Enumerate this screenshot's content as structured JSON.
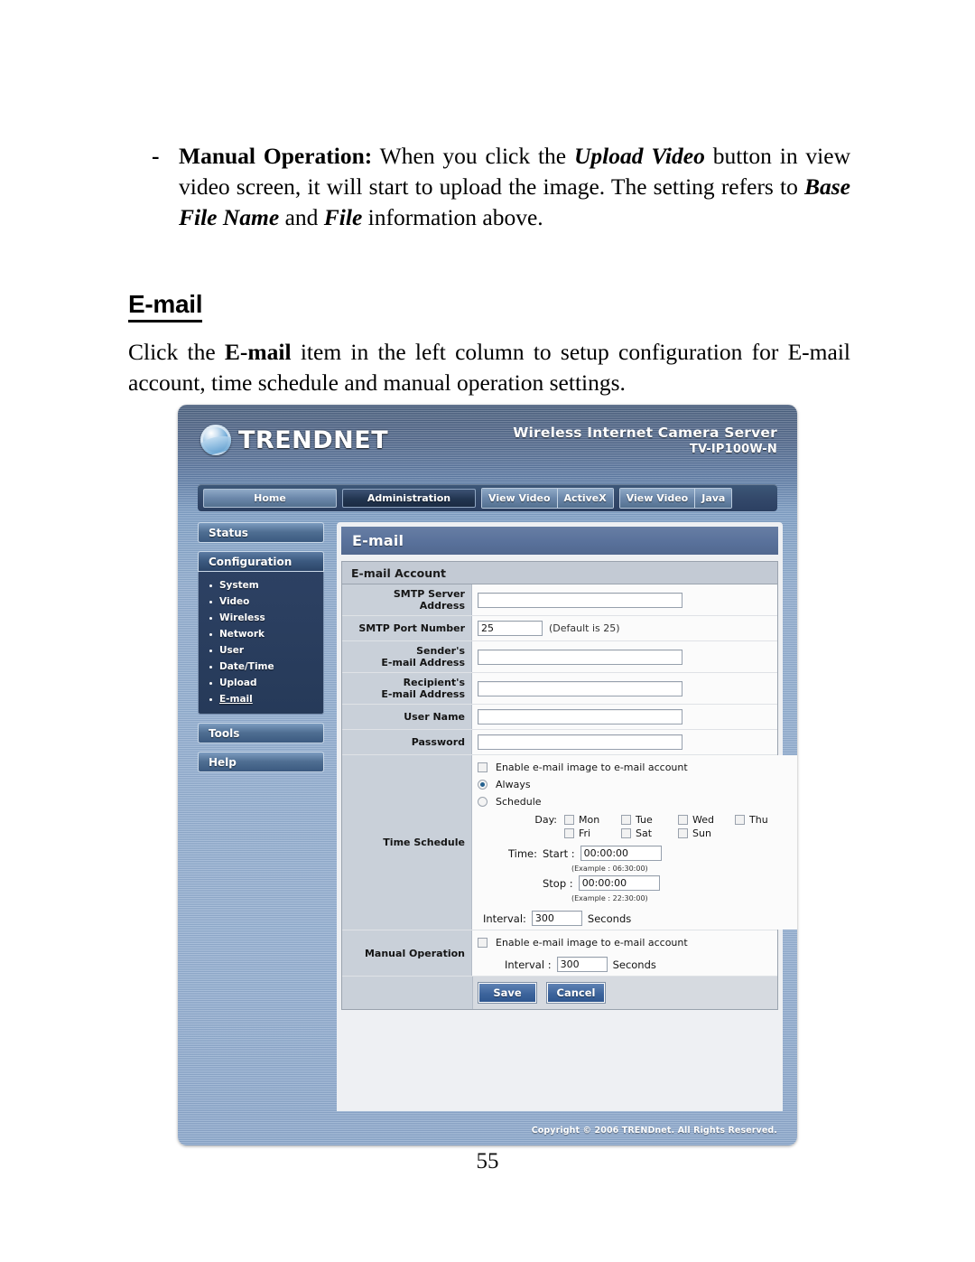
{
  "document": {
    "bullet_dash": "-",
    "manual_paragraph": {
      "lead_bold": "Manual Operation:",
      "t1": " When you click the ",
      "i1": "Upload Video",
      "t2": " button in view video screen, it will start to upload the image.  The setting refers to ",
      "i2": "Base File Name",
      "t3": " and ",
      "i3": "File",
      "t4": " information above."
    },
    "section_heading": "E-mail",
    "click_paragraph": {
      "t1": "Click the ",
      "b1": "E-mail",
      "t2": " item in the left column to setup configuration for E-mail account, time schedule and manual operation settings."
    },
    "page_number": "55"
  },
  "screenshot": {
    "brand": {
      "logo_text": "TRENDNET",
      "logo_icon": "globe-icon",
      "product_line1": "Wireless Internet Camera Server",
      "product_line2": "TV-IP100W-N"
    },
    "nav": {
      "home": "Home",
      "administration": "Administration",
      "viewvideo_activex": {
        "left": "View Video",
        "right": "ActiveX"
      },
      "viewvideo_java": {
        "left": "View Video",
        "right": "Java"
      },
      "active": "Administration"
    },
    "sidebar": {
      "status": "Status",
      "configuration": "Configuration",
      "sub_items": [
        {
          "label": "System",
          "active": false
        },
        {
          "label": "Video",
          "active": false
        },
        {
          "label": "Wireless",
          "active": false
        },
        {
          "label": "Network",
          "active": false
        },
        {
          "label": "User",
          "active": false
        },
        {
          "label": "Date/Time",
          "active": false
        },
        {
          "label": "Upload",
          "active": false
        },
        {
          "label": "E-mail",
          "active": true
        }
      ],
      "tools": "Tools",
      "help": "Help"
    },
    "panel": {
      "title": "E-mail",
      "card_header": "E-mail Account",
      "fields": {
        "smtp_server_address": {
          "label_line1": "SMTP Server",
          "label_line2": "Address",
          "value": ""
        },
        "smtp_port_number": {
          "label": "SMTP Port Number",
          "value": "25",
          "hint": "(Default is 25)"
        },
        "sender_email_address": {
          "label_line1": "Sender's",
          "label_line2": "E-mail Address",
          "value": ""
        },
        "recipient_email_address": {
          "label_line1": "Recipient's",
          "label_line2": "E-mail Address",
          "value": ""
        },
        "user_name": {
          "label": "User Name",
          "value": ""
        },
        "password": {
          "label": "Password",
          "value": ""
        }
      },
      "time_schedule": {
        "label": "Time Schedule",
        "enable_label": "Enable e-mail image to e-mail account",
        "enable_checked": false,
        "mode_always": "Always",
        "mode_schedule": "Schedule",
        "mode_selected": "Always",
        "day_label": "Day:",
        "days_row1": [
          "Mon",
          "Tue",
          "Wed",
          "Thu"
        ],
        "days_row2": [
          "Fri",
          "Sat",
          "Sun"
        ],
        "time_label": "Time:",
        "start_label": "Start :",
        "start_value": "00:00:00",
        "start_example": "(Example : 06:30:00)",
        "stop_label": "Stop :",
        "stop_value": "00:00:00",
        "stop_example": "(Example : 22:30:00)",
        "interval_label": "Interval:",
        "interval_value": "300",
        "interval_unit": "Seconds"
      },
      "manual_operation": {
        "label": "Manual Operation",
        "enable_label": "Enable e-mail image to e-mail account",
        "enable_checked": false,
        "interval_label": "Interval :",
        "interval_value": "300",
        "interval_unit": "Seconds"
      },
      "buttons": {
        "save": "Save",
        "cancel": "Cancel"
      }
    },
    "footer": {
      "copyright": "Copyright © 2006 TRENDnet. All Rights Reserved."
    },
    "colors": {
      "header_blue": "#8fabcd",
      "panel_title_blue": "#58709a",
      "label_cell": "#c9d0d9",
      "card_header": "#c3cad4",
      "button_blue": "#3d659c",
      "sidebar_dark": "#2d4163"
    }
  }
}
